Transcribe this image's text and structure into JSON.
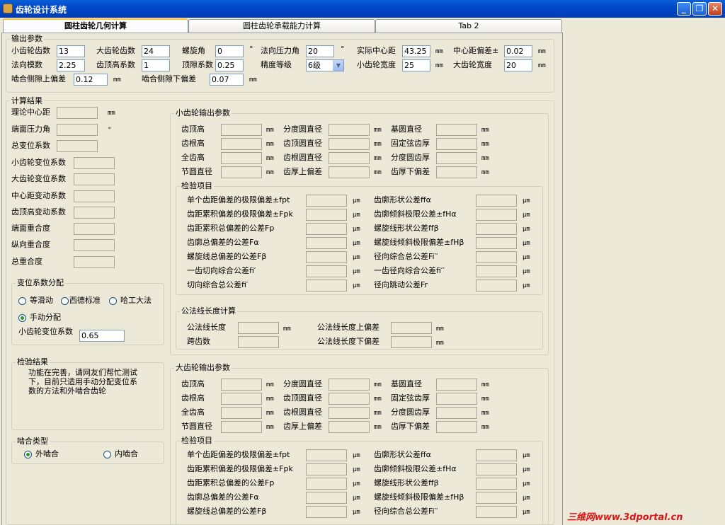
{
  "window": {
    "title": "齿轮设计系统"
  },
  "tabs": [
    "圆柱齿轮几何计算",
    "圆柱齿轮承载能力计算",
    "Tab 2"
  ],
  "input": {
    "group": "输出参数",
    "z1_label": "小齿轮齿数",
    "z1": "13",
    "z2_label": "大齿轮齿数",
    "z2": "24",
    "beta_label": "螺旋角",
    "beta": "0",
    "deg": "°",
    "alpha_label": "法向压力角",
    "alpha": "20",
    "a_label": "实际中心距",
    "a": "43.25",
    "mm": "mm",
    "fa_label": "中心距偏差±",
    "fa": "0.02",
    "mn_label": "法向模数",
    "mn": "2.25",
    "ha_label": "齿顶高系数",
    "ha": "1",
    "c_label": "顶隙系数",
    "c": "0.25",
    "grade_label": "精度等级",
    "grade": "6级",
    "b1_label": "小齿轮宽度",
    "b1": "25",
    "b2_label": "大齿轮宽度",
    "b2": "20",
    "jup_label": "啮合侧隙上偏差",
    "jup": "0.12",
    "jdn_label": "啮合侧隙下偏差",
    "jdn": "0.07"
  },
  "results": {
    "group": "计算结果",
    "items": [
      "理论中心距",
      "端面压力角",
      "总变位系数",
      "小齿轮变位系数",
      "大齿轮变位系数",
      "中心距变动系数",
      "齿顶高变动系数",
      "端面重合度",
      "纵向重合度",
      "总重合度"
    ],
    "units": [
      "mm",
      "°"
    ]
  },
  "shift": {
    "group": "变位系数分配",
    "options": [
      "等滑动",
      "西德标准",
      "哈工大法",
      "手动分配"
    ],
    "x1_label": "小齿轮变位系数",
    "x1": "0.65"
  },
  "check": {
    "group": "检验结果",
    "text": [
      "功能在完善，请网友们帮忙测试",
      "下，目前只适用手动分配变位系",
      "数的方法和外啮合齿轮"
    ]
  },
  "mesh": {
    "group": "啮合类型",
    "options": [
      "外啮合",
      "内啮合"
    ]
  },
  "pinion": {
    "group": "小齿轮输出参数",
    "geom": [
      [
        "齿顶高",
        "分度圆直径",
        "基圆直径"
      ],
      [
        "齿根高",
        "齿顶圆直径",
        "固定弦齿厚"
      ],
      [
        "全齿高",
        "齿根圆直径",
        "分度圆齿厚"
      ],
      [
        "节圆直径",
        "齿厚上偏差",
        "齿厚下偏差"
      ]
    ],
    "inspect_group": "检验项目",
    "inspect_left": [
      "单个齿距偏差的极限偏差±fpt",
      "齿距累积偏差的极限偏差±Fpk",
      "齿距累积总偏差的公差Fp",
      "齿廓总偏差的公差Fα",
      "螺旋线总偏差的公差Fβ",
      "一齿切向综合公差fi′",
      "切向综合总公差fi′"
    ],
    "inspect_right": [
      "齿廓形状公差ffα",
      "齿廓倾斜极限公差±fHα",
      "螺旋线形状公差ffβ",
      "螺旋线倾斜极限偏差±fHβ",
      "径向综合总公差Fi′′",
      "一齿径向综合公差fi′′",
      "径向跳动公差Fr"
    ],
    "um": "μm",
    "wk_group": "公法线长度计算",
    "wk": [
      "公法线长度",
      "跨齿数",
      "公法线长度上偏差",
      "公法线长度下偏差"
    ]
  },
  "gear": {
    "group": "大齿轮输出参数",
    "geom": [
      [
        "齿顶高",
        "分度圆直径",
        "基圆直径"
      ],
      [
        "齿根高",
        "齿顶圆直径",
        "固定弦齿厚"
      ],
      [
        "全齿高",
        "齿根圆直径",
        "分度圆齿厚"
      ],
      [
        "节圆直径",
        "齿厚上偏差",
        "齿厚下偏差"
      ]
    ],
    "inspect_group": "检验项目",
    "inspect_left": [
      "单个齿距偏差的极限偏差±fpt",
      "齿距累积偏差的极限偏差±Fpk",
      "齿距累积总偏差的公差Fp",
      "齿廓总偏差的公差Fα",
      "螺旋线总偏差的公差Fβ"
    ],
    "inspect_right": [
      "齿廓形状公差ffα",
      "齿廓倾斜极限公差±fHα",
      "螺旋线形状公差ffβ",
      "螺旋线倾斜极限偏差±fHβ",
      "径向综合总公差Fi′′"
    ]
  },
  "watermark": "三维网www.3dportal.cn"
}
